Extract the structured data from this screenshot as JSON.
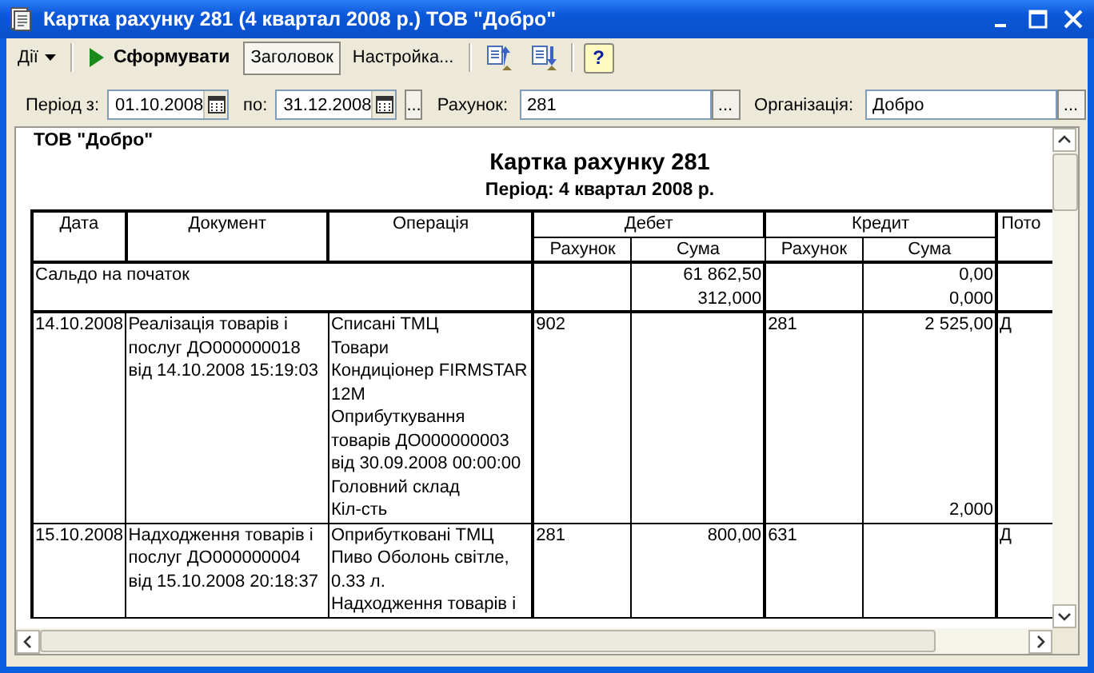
{
  "window": {
    "title": "Картка рахунку 281 (4 квартал 2008 р.) ТОВ \"Добро\""
  },
  "toolbar": [
    {
      "kind": "menu",
      "label": "Дії"
    },
    {
      "kind": "separator"
    },
    {
      "kind": "run",
      "label": "Сформувати"
    },
    {
      "kind": "toggle",
      "label": "Заголовок",
      "pressed": true
    },
    {
      "kind": "toggle",
      "label": "Настройка...",
      "pressed": false
    },
    {
      "kind": "separator"
    },
    {
      "kind": "move-up"
    },
    {
      "kind": "move-down"
    },
    {
      "kind": "separator"
    },
    {
      "kind": "help",
      "label": "?"
    }
  ],
  "filters": [
    {
      "kind": "label",
      "text": "Період з:"
    },
    {
      "kind": "date",
      "value": "01.10.2008"
    },
    {
      "kind": "label",
      "text": "по:"
    },
    {
      "kind": "date",
      "value": "31.12.2008"
    },
    {
      "kind": "dots",
      "text": "..."
    },
    {
      "kind": "label",
      "text": "Рахунок:"
    },
    {
      "kind": "select",
      "value": "281",
      "button": "..."
    },
    {
      "kind": "label",
      "text": "Організація:"
    },
    {
      "kind": "select",
      "value": "Добро",
      "button": "..."
    }
  ],
  "report": {
    "organization": "ТОВ \"Добро\"",
    "title": "Картка рахунку 281",
    "period": "Період: 4 квартал 2008 р.",
    "header": [
      {
        "label": "Дата"
      },
      {
        "label": "Документ"
      },
      {
        "label": "Операція"
      },
      {
        "label": "Дебет",
        "sub": [
          "Рахунок",
          "Сума"
        ]
      },
      {
        "label": "Кредит",
        "sub": [
          "Рахунок",
          "Сума"
        ]
      },
      {
        "label": "Пото"
      }
    ],
    "opening": {
      "label": "Сальдо на початок",
      "debit_sum": [
        "61 862,50",
        "312,000"
      ],
      "credit_sum": [
        "0,00",
        "0,000"
      ]
    },
    "rows": [
      {
        "date": "14.10.2008",
        "document": "Реалізація товарів і\nпослуг ДО000000018\nвід 14.10.2008 15:19:03",
        "operation": [
          "Списані ТМЦ",
          "Товари",
          "Кондиціонер FIRMSTAR\n12M",
          "Оприбуткування\nтоварів ДО000000003\nвід 30.09.2008 00:00:00",
          "Головний склад",
          "Кіл-сть"
        ],
        "debit_account": "902",
        "credit_account": "281",
        "credit_sum": "2 525,00",
        "credit_qty": "2,000",
        "column_8": "Д"
      },
      {
        "date": "15.10.2008",
        "document": "Надходження товарів і\nпослуг ДО000000004\nвід 15.10.2008 20:18:37",
        "operation": [
          "Оприбутковані ТМЦ",
          "Пиво Оболонь світле,\n0.33 л.",
          "Надходження товарів і"
        ],
        "debit_account": "281",
        "debit_sum": "800,00",
        "credit_account": "631",
        "column_8": "Д"
      }
    ]
  }
}
